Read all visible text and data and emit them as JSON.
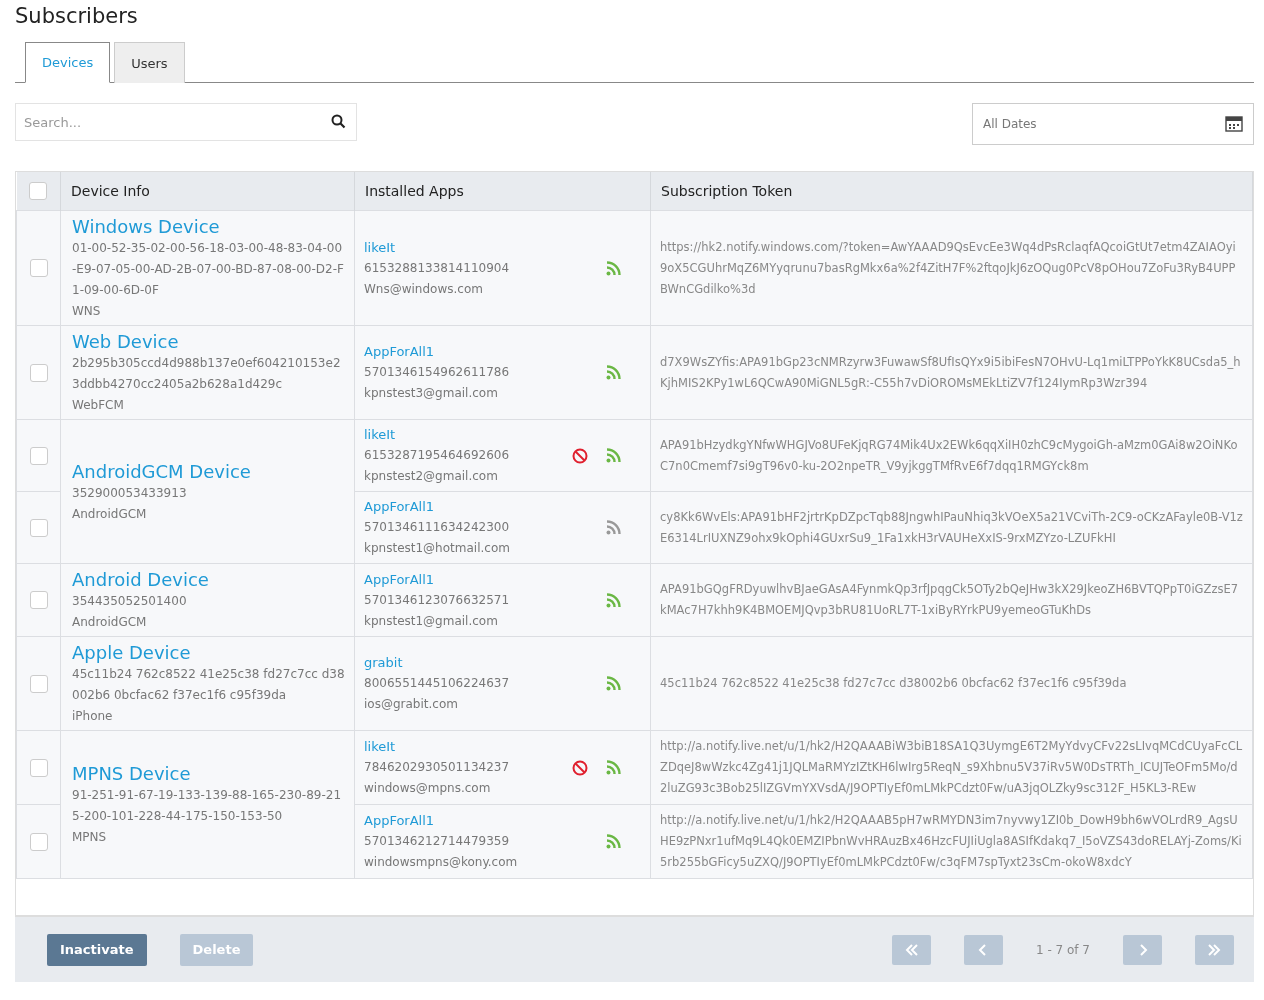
{
  "title": "Subscribers",
  "tabs": [
    {
      "label": "Devices",
      "selected": true
    },
    {
      "label": "Users",
      "selected": false
    }
  ],
  "search": {
    "placeholder": "Search..."
  },
  "date_filter": {
    "value": "All Dates"
  },
  "table": {
    "header_checked": false,
    "columns": [
      "Device Info",
      "Installed Apps",
      "Subscription Token"
    ],
    "devices": [
      {
        "name": "Windows Device",
        "identifier": "01-00-52-35-02-00-56-18-03-00-48-83-04-00-E9-07-05-00-AD-2B-07-00-BD-87-08-00-D2-F1-09-00-6D-0F",
        "platform": "WNS",
        "subscriptions": [
          {
            "checked": false,
            "app": "likeIt",
            "app_id": "6153288133814110904",
            "email": "Wns@windows.com",
            "blocked": false,
            "active": true,
            "token": "https://hk2.notify.windows.com/?token=AwYAAAD9QsEvcEe3Wq4dPsRclaqfAQcoiGtUt7etm4ZAIAOyi9oX5CGUhrMqZ6MYyqrunu7basRgMkx6a%2f4ZitH7F%2ftqoJkJ6zOQug0PcV8pOHou7ZoFu3RyB4UPPBWnCGdilko%3d"
          }
        ]
      },
      {
        "name": "Web Device",
        "identifier": "2b295b305ccd4d988b137e0ef604210153e23ddbb4270cc2405a2b628a1d429c",
        "platform": "WebFCM",
        "subscriptions": [
          {
            "checked": false,
            "app": "AppForAll1",
            "app_id": "5701346154962611786",
            "email": "kpnstest3@gmail.com",
            "blocked": false,
            "active": true,
            "token": "d7X9WsZYfis:APA91bGp23cNMRzyrw3FuwawSf8UfIsQYx9i5ibiFesN7OHvU-Lq1miLTPPoYkK8UCsda5_hKjhMIS2KPy1wL6QCwA90MiGNL5gR:-C55h7vDiOROMsMEkLtiZV7f124IymRp3Wzr394"
          }
        ]
      },
      {
        "name": "AndroidGCM Device",
        "identifier": "352900053433913",
        "platform": "AndroidGCM",
        "subscriptions": [
          {
            "checked": false,
            "app": "likeIt",
            "app_id": "6153287195464692606",
            "email": "kpnstest2@gmail.com",
            "blocked": true,
            "active": true,
            "token": "APA91bHzydkgYNfwWHGJVo8UFeKjqRG74Mik4Ux2EWk6qqXiIH0zhC9cMygoiGh-aMzm0GAi8w2OiNKoC7n0Cmemf7si9gT96v0-ku-2O2npeTR_V9yjkggTMfRvE6f7dqq1RMGYck8m"
          },
          {
            "checked": false,
            "app": "AppForAll1",
            "app_id": "5701346111634242300",
            "email": "kpnstest1@hotmail.com",
            "blocked": false,
            "active": false,
            "token": "cy8Kk6WvEls:APA91bHF2jrtrKpDZpcTqb88JngwhIPauNhiq3kVOeX5a21VCviTh-2C9-oCKzAFayle0B-V1zE6314LrIUXNZ9ohx9kOphi4GUxrSu9_1Fa1xkH3rVAUHeXxIS-9rxMZYzo-LZUFkHI"
          }
        ]
      },
      {
        "name": "Android Device",
        "identifier": "354435052501400",
        "platform": "AndroidGCM",
        "subscriptions": [
          {
            "checked": false,
            "app": "AppForAll1",
            "app_id": "5701346123076632571",
            "email": "kpnstest1@gmail.com",
            "blocked": false,
            "active": true,
            "token": "APA91bGQgFRDyuwlhvBJaeGAsA4FynmkQp3rfJpqgCk5OTy2bQeJHw3kX29JkeoZH6BVTQPpT0iGZzsE7kMAc7H7khh9K4BMOEMJQvp3bRU81UoRL7T-1xiByRYrkPU9yemeoGTuKhDs"
          }
        ]
      },
      {
        "name": "Apple Device",
        "identifier": "45c11b24 762c8522 41e25c38 fd27c7cc d38002b6 0bcfac62 f37ec1f6 c95f39da",
        "platform": "iPhone",
        "subscriptions": [
          {
            "checked": false,
            "app": "grabit",
            "app_id": "8006551445106224637",
            "email": "ios@grabit.com",
            "blocked": false,
            "active": true,
            "token": "45c11b24 762c8522 41e25c38 fd27c7cc d38002b6 0bcfac62 f37ec1f6 c95f39da"
          }
        ]
      },
      {
        "name": "MPNS Device",
        "identifier": "91-251-91-67-19-133-139-88-165-230-89-215-200-101-228-44-175-150-153-50",
        "platform": "MPNS",
        "subscriptions": [
          {
            "checked": false,
            "app": "likeIt",
            "app_id": "7846202930501134237",
            "email": "windows@mpns.com",
            "blocked": true,
            "active": true,
            "token": "http://a.notify.live.net/u/1/hk2/H2QAAABiW3biB18SA1Q3UymgE6T2MyYdvyCFv22sLIvqMCdCUyaFcCLZDqeJ8wWzkc4Zg41j1JQLMaRMYzIZtKH6lwIrg5ReqN_s9Xhbnu5V37iRv5W0DsTRTh_ICUJTeOFm5Mo/d2luZG93c3Bob25lIZGVmYXVsdA/J9OPTIyEf0mLMkPCdzt0Fw/uA3jqOLZky9sc312F_H5KL3-REw"
          },
          {
            "checked": false,
            "app": "AppForAll1",
            "app_id": "5701346212714479359",
            "email": "windowsmpns@kony.com",
            "blocked": false,
            "active": true,
            "token": "http://a.notify.live.net/u/1/hk2/H2QAAAB5pH7wRMYDN3im7nyvwy1ZI0b_DowH9bh6wVOLrdR9_AgsUHE9zPNxr1ufMq9L4Qk0EMZIPbnWvHRAuzBx46HzcFUJIiUgla8ASIfKdakq7_I5oVZS43doRELAYj-Zoms/Ki5rb255bGFicy5uZXQ/J9OPTIyEf0mLMkPCdzt0Fw/c3qFM7spTyxt23sCm-okoW8xdcY"
          }
        ]
      }
    ]
  },
  "actions": [
    {
      "label": "Inactivate",
      "disabled": false
    },
    {
      "label": "Delete",
      "disabled": true
    }
  ],
  "pagination": {
    "range": "1 - 7 of 7",
    "first_disabled": true,
    "prev_disabled": true,
    "next_disabled": true,
    "last_disabled": true
  }
}
